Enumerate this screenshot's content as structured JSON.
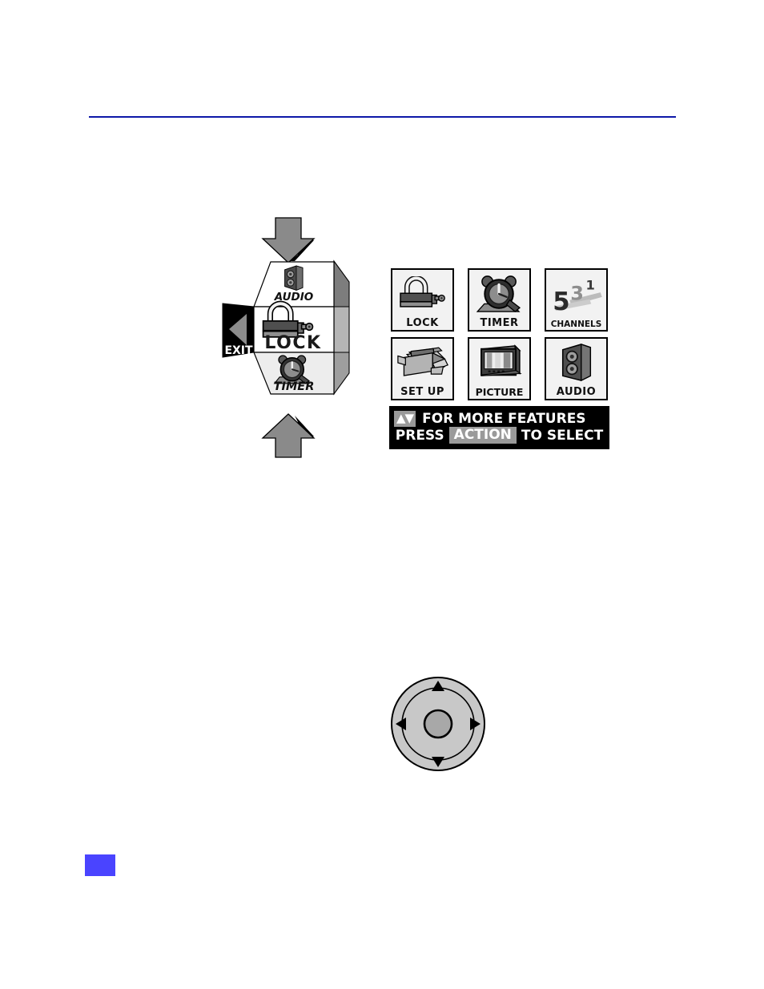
{
  "page": {
    "background_color": "#ffffff",
    "rule_color": "#0d18a8",
    "page_number_swatch_color": "#4a44ff"
  },
  "carousel_figure": {
    "name": "on-screen-menu-carousel",
    "description": "3D rotating icon carousel with EXIT tab on the left and up/down arrows above and below",
    "exit_tab": {
      "label": "EXIT",
      "arrow_icon": "triangle-left-icon",
      "background_color": "#000000",
      "arrow_color": "#8c8c8c"
    },
    "arrow_up_icon": "arrow-up-icon",
    "arrow_down_icon": "arrow-down-icon",
    "arrow_color": "#8a8a8a",
    "arrow_shadow_color": "#000000",
    "faces": [
      {
        "label": "AUDIO",
        "icon": "speaker-icon",
        "position": "top",
        "face_color": "#ffffff"
      },
      {
        "label": "LOCK",
        "icon": "padlock-icon",
        "position": "center",
        "face_color": "#ffffff"
      },
      {
        "label": "TIMER",
        "icon": "alarm-clock-icon",
        "position": "bottom",
        "face_color": "#ededed"
      }
    ],
    "side_panel_colors": [
      "#7d7d7d",
      "#b5b5b5",
      "#9e9e9e"
    ]
  },
  "osd_figure": {
    "name": "on-screen-display-main-menu",
    "icons": [
      {
        "label": "LOCK",
        "icon": "padlock-icon"
      },
      {
        "label": "TIMER",
        "icon": "alarm-clock-icon"
      },
      {
        "label": "CHANNELS",
        "icon": "channel-numbers-icon",
        "numerals": [
          "5",
          "3",
          "1"
        ]
      },
      {
        "label": "SET UP",
        "icon": "open-box-icon"
      },
      {
        "label": "PICTURE",
        "icon": "television-icon"
      },
      {
        "label": "AUDIO",
        "icon": "speaker-icon"
      }
    ],
    "banner": {
      "background_color": "#000000",
      "chip_color": "#9a9a9a",
      "line1": {
        "arrows": "▲▼",
        "text": "FOR MORE FEATURES"
      },
      "line2": {
        "prefix": "PRESS",
        "chip": "ACTION",
        "suffix": "TO SELECT"
      }
    }
  },
  "navring_figure": {
    "name": "remote-navigation-ring",
    "description": "Circular four-way navigation pad with center select button",
    "outer_ring_color": "#c8c8c8",
    "inner_disc_color": "#c8c8c8",
    "center_button_color": "#a8a8a8",
    "outline_color": "#000000",
    "directions": [
      {
        "name": "nav-up-arrow",
        "icon": "triangle-up-icon"
      },
      {
        "name": "nav-right-arrow",
        "icon": "triangle-right-icon"
      },
      {
        "name": "nav-down-arrow",
        "icon": "triangle-down-icon"
      },
      {
        "name": "nav-left-arrow",
        "icon": "triangle-left-icon"
      }
    ],
    "center": {
      "name": "nav-center-select-button",
      "icon": "circle-icon"
    }
  }
}
